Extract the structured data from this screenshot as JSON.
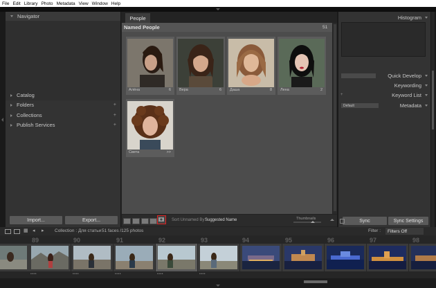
{
  "menu": [
    "File",
    "Edit",
    "Library",
    "Photo",
    "Metadata",
    "View",
    "Window",
    "Help"
  ],
  "left_panel": {
    "navigator": "Navigator",
    "sections": [
      {
        "label": "Catalog",
        "plus": ""
      },
      {
        "label": "Folders",
        "plus": "+"
      },
      {
        "label": "Collections",
        "plus": "+"
      },
      {
        "label": "Publish Services",
        "plus": "+"
      }
    ],
    "import_label": "Import...",
    "export_label": "Export..."
  },
  "center": {
    "tab": "People",
    "section_title": "Named People",
    "section_count": "51",
    "people": [
      {
        "name": "Алёна",
        "count": "6"
      },
      {
        "name": "Вера",
        "count": "6"
      },
      {
        "name": "Даша",
        "count": "8"
      },
      {
        "name": "Лена",
        "count": "2"
      },
      {
        "name": "Света",
        "count": ">>"
      }
    ],
    "toolbar": {
      "sort_label": "Sort Unnamed By :",
      "sort_value": "Suggested Name",
      "thumbnails_label": "Thumbnails"
    }
  },
  "right_panel": {
    "histogram": "Histogram",
    "quick_develop": "Quick Develop",
    "keywording": "Keywording",
    "keyword_list": "Keyword List",
    "metadata": "Metadata",
    "metadata_preset": "Default",
    "sync_label": "Sync",
    "sync_settings_label": "Sync Settings"
  },
  "filmstrip": {
    "collection_label": "Collection : Для статьи",
    "counts": "51 faces /125 photos",
    "filter_label": "Filter :",
    "filter_value": "Filters Off",
    "numbers": [
      "89",
      "90",
      "91",
      "92",
      "93",
      "94",
      "95",
      "96",
      "97",
      "98"
    ],
    "selected_index": 4
  },
  "colors": {
    "panel": "#333333",
    "center_bg": "#4c4c4c",
    "highlight_red": "#e02020"
  }
}
